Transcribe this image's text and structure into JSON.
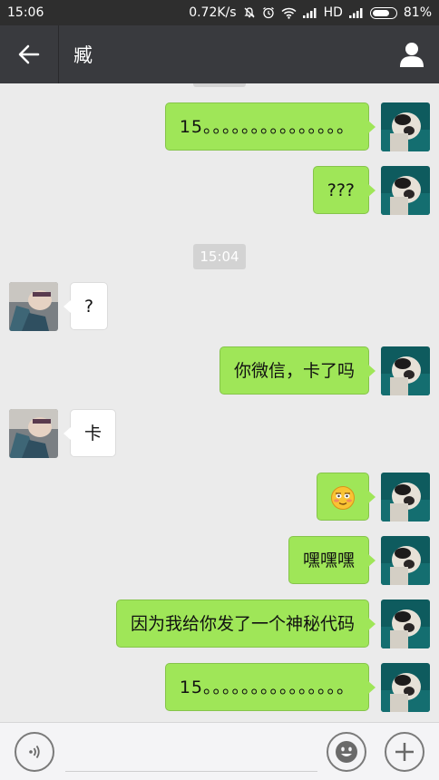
{
  "status_bar": {
    "time": "15:06",
    "speed": "0.72K/s",
    "network": "HD",
    "battery": "81%",
    "battery_level": 0.81
  },
  "header": {
    "title": "臧"
  },
  "messages": {
    "m1": "15。。。。。。。。。。。。。。。",
    "m2": "???",
    "time1": "15:04",
    "m3": "?",
    "m4": "你微信，卡了吗",
    "m5": "卡",
    "m6_emoji": "blush-emoji",
    "m7": "嘿嘿嘿",
    "m8": "因为我给你发了一个神秘代码",
    "m9": "15。。。。。。。。。。。。。。。"
  },
  "input": {
    "placeholder": ""
  },
  "colors": {
    "bubble_out": "#9fe658",
    "bubble_in": "#ffffff",
    "header_bg": "#393a3e",
    "chat_bg": "#ebebeb"
  }
}
